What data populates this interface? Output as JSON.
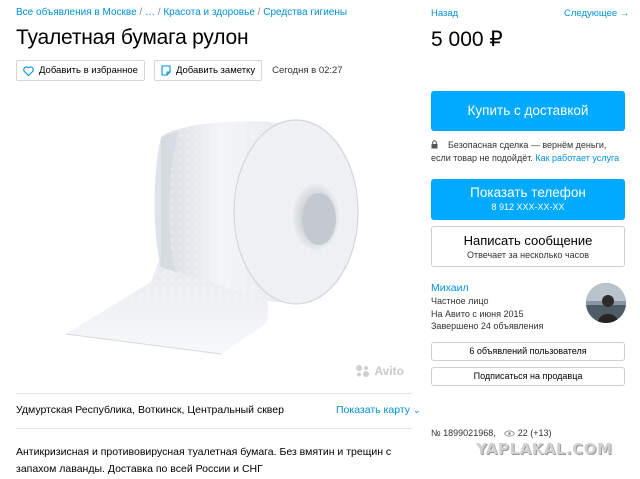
{
  "breadcrumbs": {
    "item1": "Все объявления в Москве",
    "item2": "…",
    "item3": "Красота и здоровье",
    "item4": "Средства гигиены",
    "sep": " / "
  },
  "listing": {
    "title": "Туалетная бумага рулон",
    "add_favorite": "Добавить в избранное",
    "add_note": "Добавить заметку",
    "date": "Сегодня в 02:27",
    "watermark": "Avito",
    "location": "Удмуртская Республика, Воткинск, Центральный сквер",
    "show_map": "Показать карту",
    "description": "Антикризисная и противовирусная туалетная бумага. Без вмятин и трещин с запахом лаванды. Доставка по всей России и СНГ"
  },
  "sidebar": {
    "back": "Назад",
    "next": "Следующее →",
    "price": "5 000 ₽",
    "buy_button": "Купить с доставкой",
    "safe_text": "Безопасная сделка — вернём деньги, если товар не подойдёт.",
    "safe_link": "Как работает услуга",
    "phone_label": "Показать телефон",
    "phone_number": "8 912 XXX-XX-XX",
    "message_label": "Написать сообщение",
    "message_sub": "Отвечает за несколько часов",
    "seller_name": "Михаил",
    "seller_type": "Частное лицо",
    "seller_since": "На Авито с июня 2015",
    "seller_done": "Завершено 24 объявления",
    "user_ads": "6 объявлений пользователя",
    "subscribe": "Подписаться на продавца",
    "ad_number": "№ 1899021968,",
    "views": "22 (+13)"
  },
  "overlay": {
    "site_watermark": "YAPLAKAL.COM"
  },
  "colors": {
    "link": "#0091d9",
    "button": "#00aaff"
  }
}
